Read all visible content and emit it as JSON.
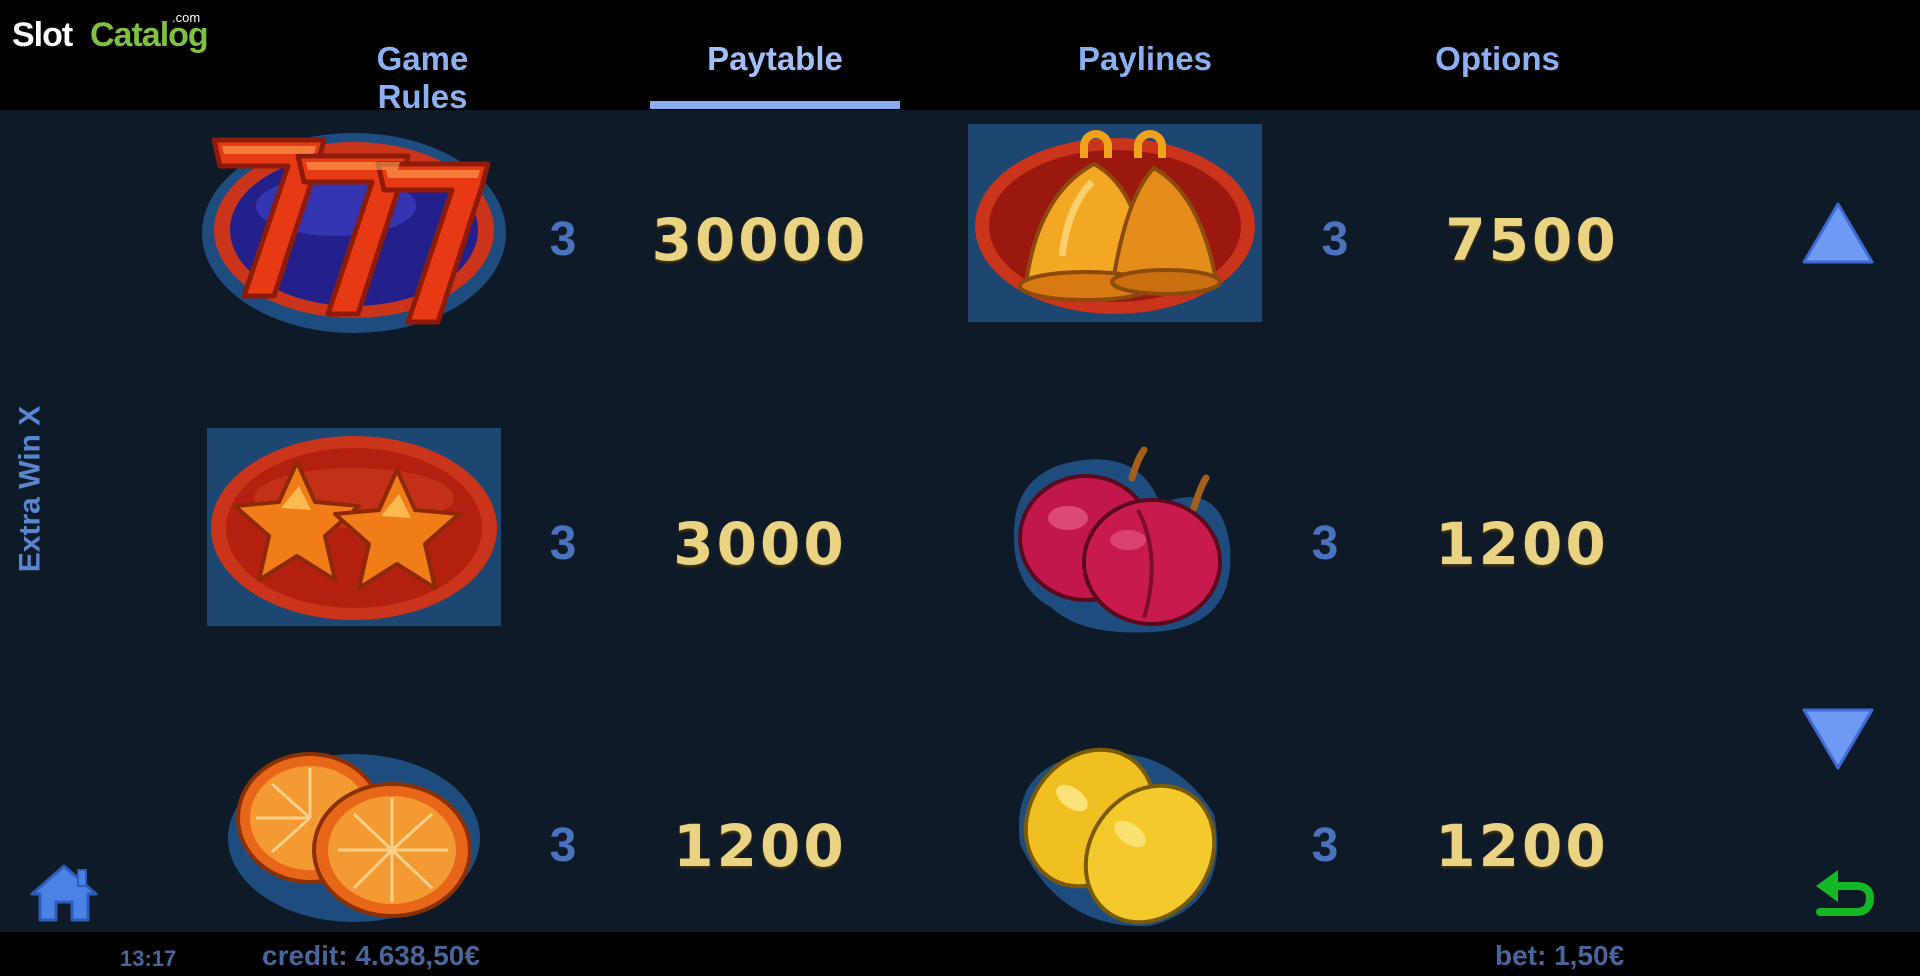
{
  "brand": {
    "logo_main": "Slot",
    "logo_accent": "Catalog",
    "logo_suffix": ".com"
  },
  "tabs": [
    {
      "label": "Game Rules"
    },
    {
      "label": "Paytable",
      "active": true
    },
    {
      "label": "Paylines"
    },
    {
      "label": "Options"
    }
  ],
  "game_title": "Extra Win X",
  "paytable": [
    {
      "symbol": "sevens-icon",
      "count": "3",
      "value": "30000"
    },
    {
      "symbol": "bells-icon",
      "count": "3",
      "value": "7500"
    },
    {
      "symbol": "stars-icon",
      "count": "3",
      "value": "3000"
    },
    {
      "symbol": "plums-icon",
      "count": "3",
      "value": "1200"
    },
    {
      "symbol": "oranges-icon",
      "count": "3",
      "value": "1200"
    },
    {
      "symbol": "lemons-icon",
      "count": "3",
      "value": "1200"
    }
  ],
  "status": {
    "time": "13:17",
    "credit": "credit: 4.638,50€",
    "bet": "bet: 1,50€"
  },
  "colors": {
    "background": "#0e1a28",
    "tab_text": "#8bb0f2",
    "value_text": "#ead383",
    "count_text": "#4a72bd",
    "back_icon": "#14b827"
  }
}
